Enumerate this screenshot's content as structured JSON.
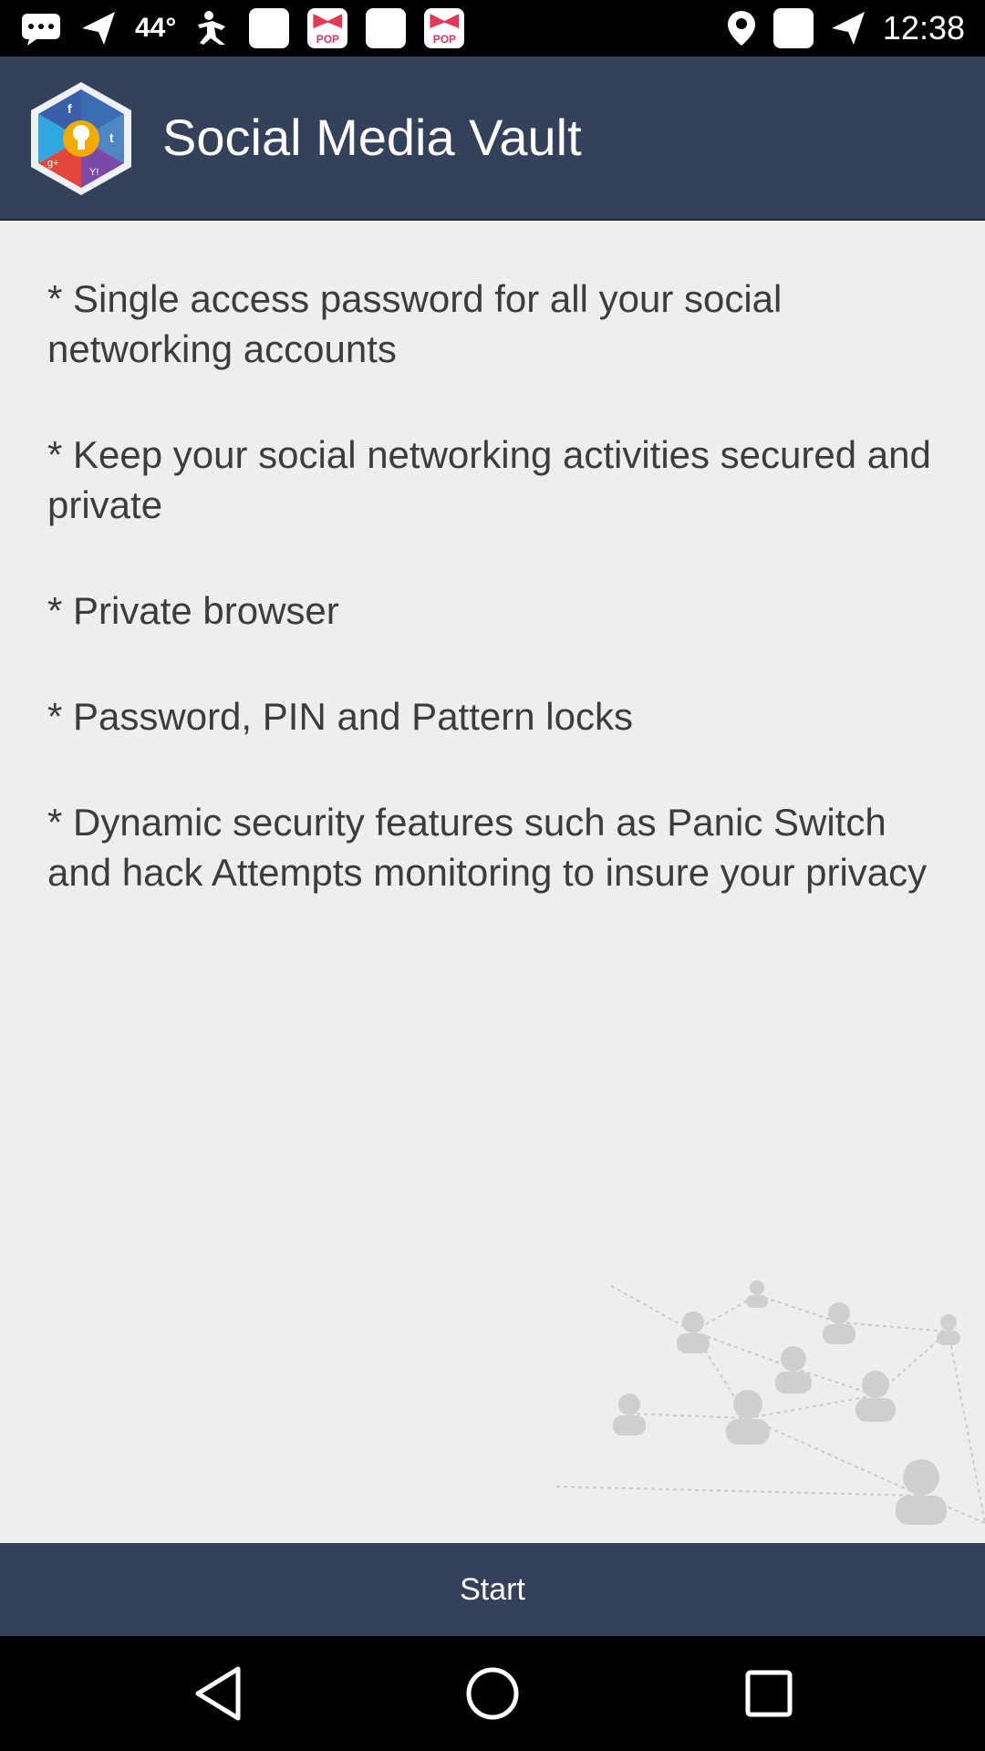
{
  "status_bar": {
    "temperature": "44°",
    "time": "12:38",
    "notification_icons": [
      "messages-icon",
      "send-icon",
      "fitness-icon",
      "white-square-icon",
      "pop-app-icon",
      "white-square-icon",
      "pop-app-icon",
      "location-icon",
      "white-square-icon",
      "send-icon"
    ],
    "pop_label": "POP"
  },
  "header": {
    "title": "Social Media Vault",
    "logo_icon": "social-vault-hexagon-logo",
    "background": "#33425a"
  },
  "features": [
    "* Single access password for all your social networking accounts",
    "* Keep your social networking activities secured and private",
    "* Private browser",
    "* Password, PIN and Pattern locks",
    "* Dynamic security features such as Panic Switch and hack Attempts monitoring to insure your privacy"
  ],
  "start_button": {
    "label": "Start"
  },
  "nav_bar": {
    "buttons": [
      "back-icon",
      "home-icon",
      "recents-icon"
    ]
  }
}
